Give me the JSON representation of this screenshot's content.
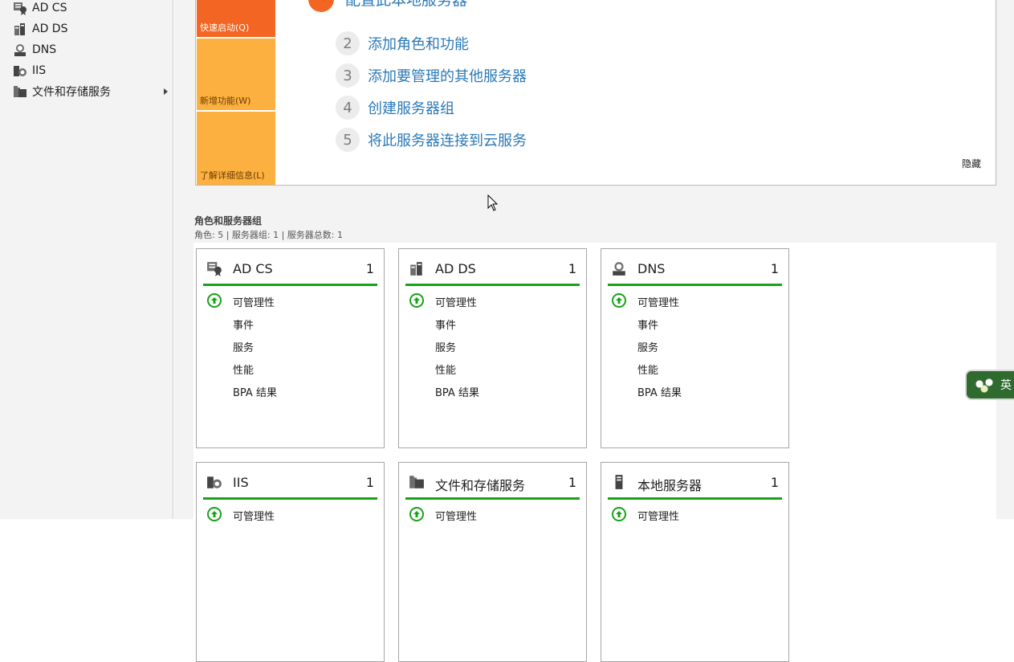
{
  "sidebar": {
    "items": [
      {
        "label": "AD CS",
        "icon": "certificate-icon"
      },
      {
        "label": "AD DS",
        "icon": "directory-icon"
      },
      {
        "label": "DNS",
        "icon": "dns-icon"
      },
      {
        "label": "IIS",
        "icon": "iis-icon"
      },
      {
        "label": "文件和存储服务",
        "icon": "file-storage-icon",
        "expandable": true
      }
    ]
  },
  "quickstart": {
    "tiles": [
      {
        "label": "快速启动(Q)"
      },
      {
        "label": "新增功能(W)"
      },
      {
        "label": "了解详细信息(L)"
      }
    ],
    "partial_step_text": "配置此本地服务器",
    "steps": [
      {
        "num": "2",
        "label": "添加角色和功能"
      },
      {
        "num": "3",
        "label": "添加要管理的其他服务器"
      },
      {
        "num": "4",
        "label": "创建服务器组"
      },
      {
        "num": "5",
        "label": "将此服务器连接到云服务"
      }
    ],
    "hide_label": "隐藏"
  },
  "roles": {
    "title": "角色和服务器组",
    "subtitle": "角色: 5 | 服务器组: 1 | 服务器总数: 1",
    "row_labels": [
      "可管理性",
      "事件",
      "服务",
      "性能",
      "BPA 结果"
    ],
    "cards": [
      {
        "title": "AD CS",
        "count": "1",
        "icon": "certificate-icon"
      },
      {
        "title": "AD DS",
        "count": "1",
        "icon": "directory-icon"
      },
      {
        "title": "DNS",
        "count": "1",
        "icon": "dns-icon"
      },
      {
        "title": "IIS",
        "count": "1",
        "icon": "iis-icon"
      },
      {
        "title": "文件和存储服务",
        "count": "1",
        "icon": "file-storage-icon"
      },
      {
        "title": "本地服务器",
        "count": "1",
        "icon": "server-icon"
      }
    ]
  },
  "ime": {
    "label": "英"
  },
  "colors": {
    "accent_orange": "#f26522",
    "tile_yellow": "#fbb040",
    "link_blue": "#2b79b7",
    "status_green": "#17a317"
  }
}
